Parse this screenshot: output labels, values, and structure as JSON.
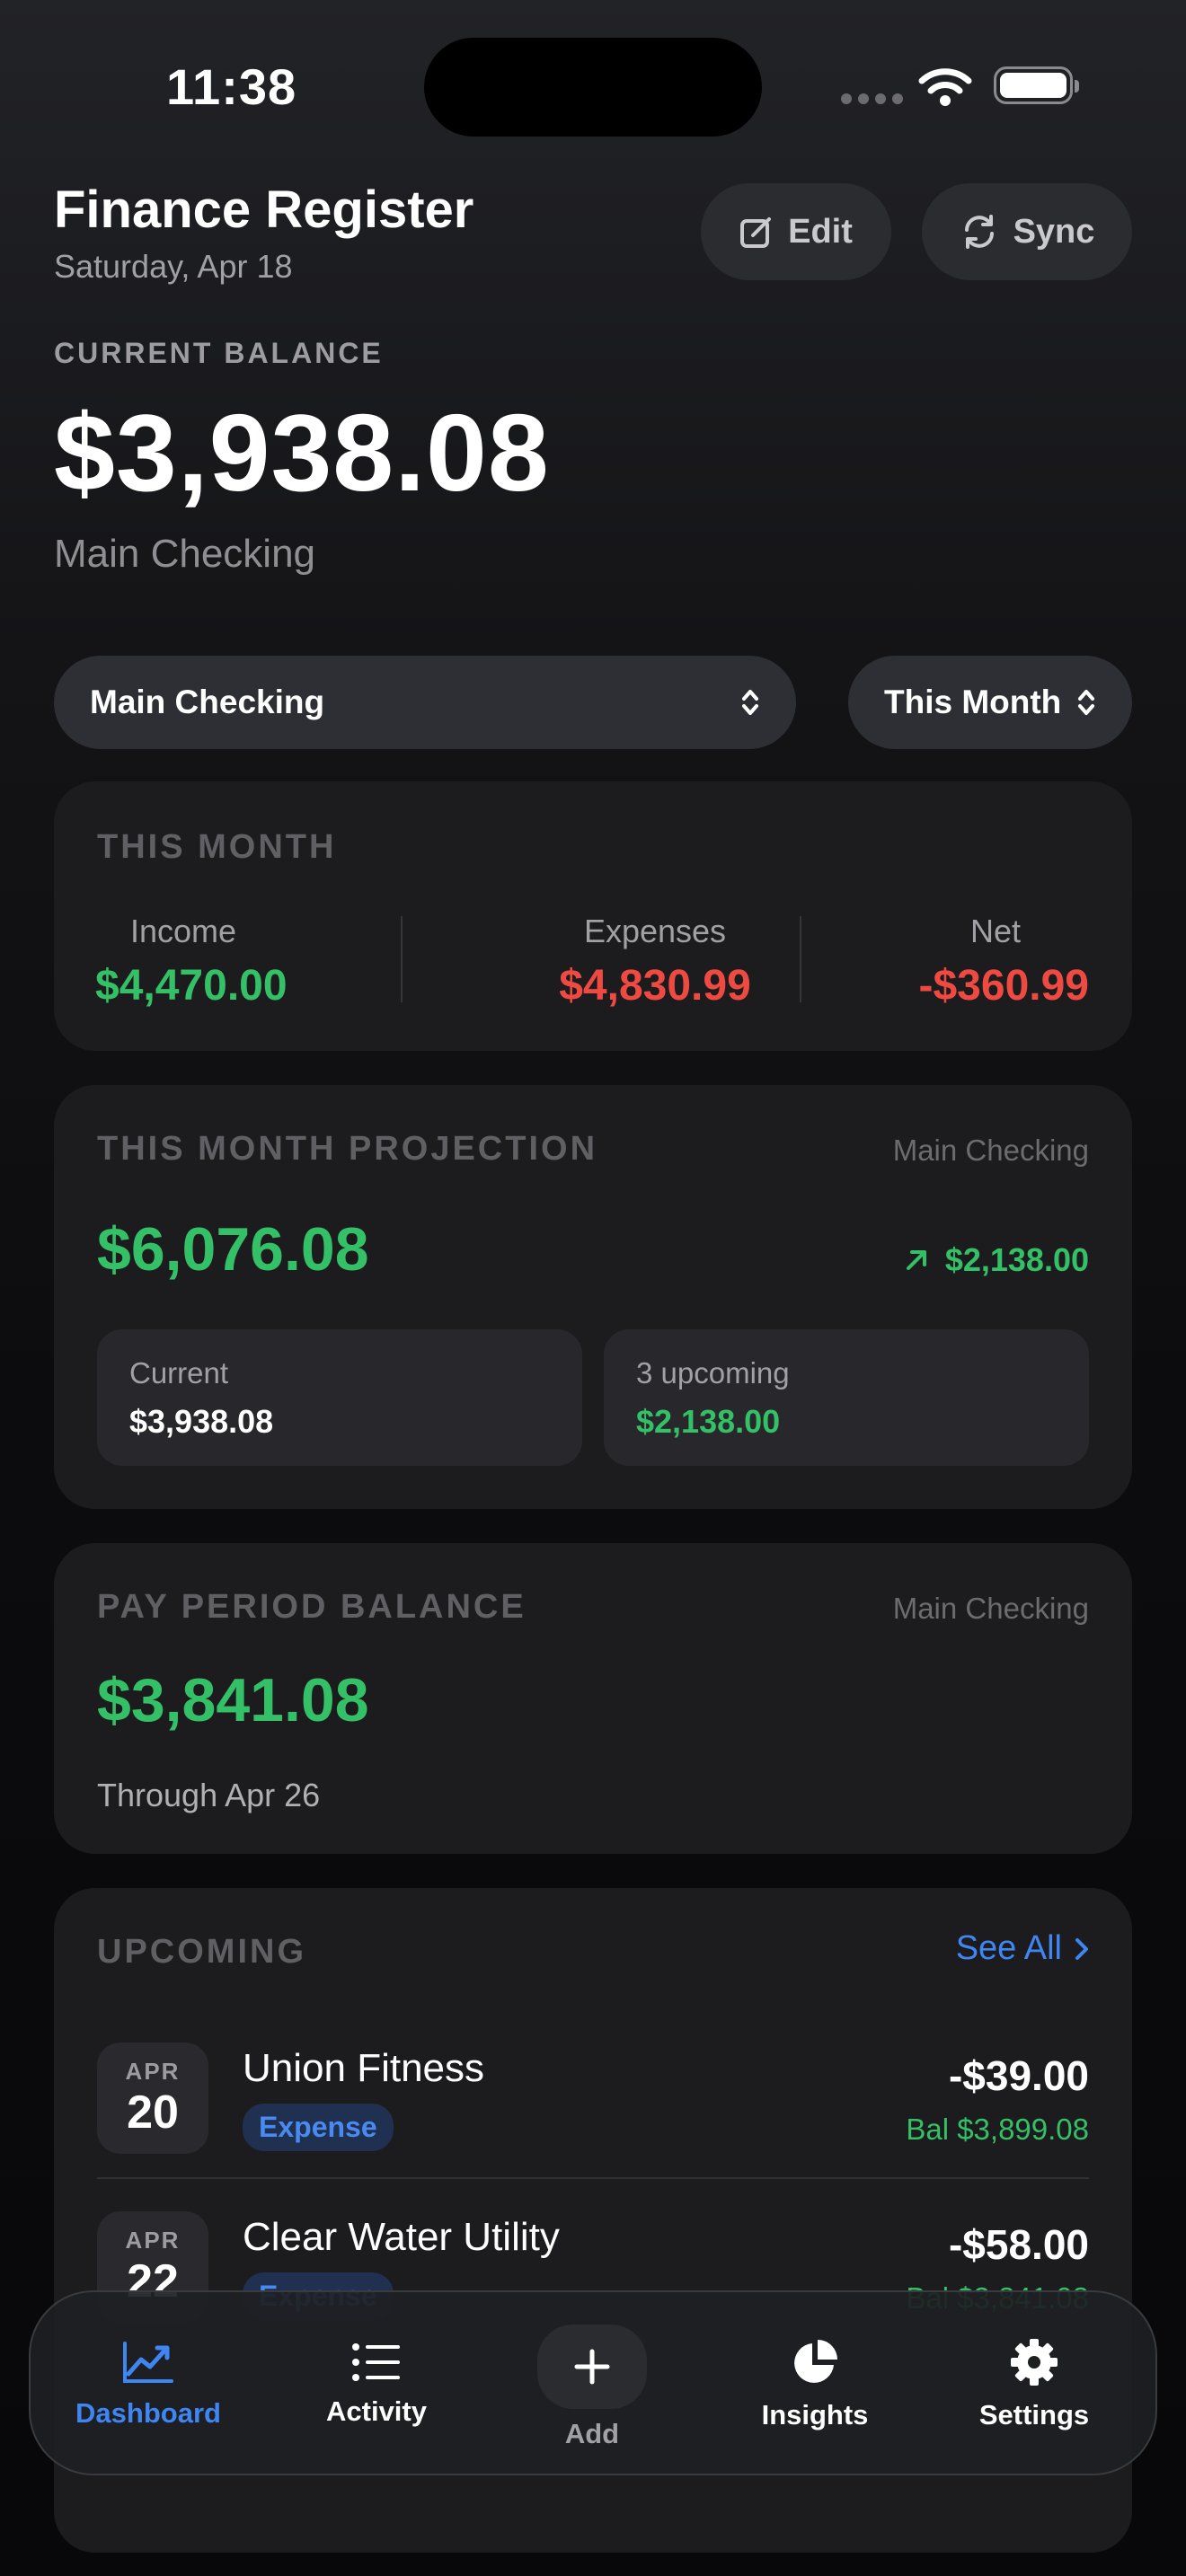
{
  "status_bar": {
    "time": "11:38"
  },
  "header": {
    "title": "Finance Register",
    "date": "Saturday, Apr 18",
    "edit_label": "Edit",
    "sync_label": "Sync"
  },
  "balance": {
    "label": "CURRENT BALANCE",
    "amount": "$3,938.08",
    "account": "Main Checking"
  },
  "filters": {
    "account": "Main Checking",
    "range": "This Month"
  },
  "summary": {
    "label": "THIS MONTH",
    "income_label": "Income",
    "income": "$4,470.00",
    "expenses_label": "Expenses",
    "expenses": "$4,830.99",
    "net_label": "Net",
    "net": "-$360.99"
  },
  "projection": {
    "label": "THIS MONTH PROJECTION",
    "account": "Main Checking",
    "amount": "$6,076.08",
    "change": "$2,138.00",
    "current_label": "Current",
    "current": "$3,938.08",
    "upcoming_label": "3 upcoming",
    "upcoming": "$2,138.00"
  },
  "pay_period": {
    "label": "PAY PERIOD BALANCE",
    "account": "Main Checking",
    "amount": "$3,841.08",
    "through": "Through Apr 26"
  },
  "upcoming": {
    "label": "UPCOMING",
    "see_all": "See All",
    "items": [
      {
        "month": "APR",
        "day": "20",
        "name": "Union Fitness",
        "type": "Expense",
        "amount": "-$39.00",
        "balance": "Bal $3,899.08"
      },
      {
        "month": "APR",
        "day": "22",
        "name": "Clear Water Utility",
        "type": "Expense",
        "amount": "-$58.00",
        "balance": "Bal $3,841.08"
      }
    ]
  },
  "tabbar": {
    "dashboard": "Dashboard",
    "activity": "Activity",
    "add": "Add",
    "insights": "Insights",
    "settings": "Settings"
  },
  "colors": {
    "accent": "#3f86f2",
    "positive": "#34c066",
    "negative": "#ef4a42"
  }
}
